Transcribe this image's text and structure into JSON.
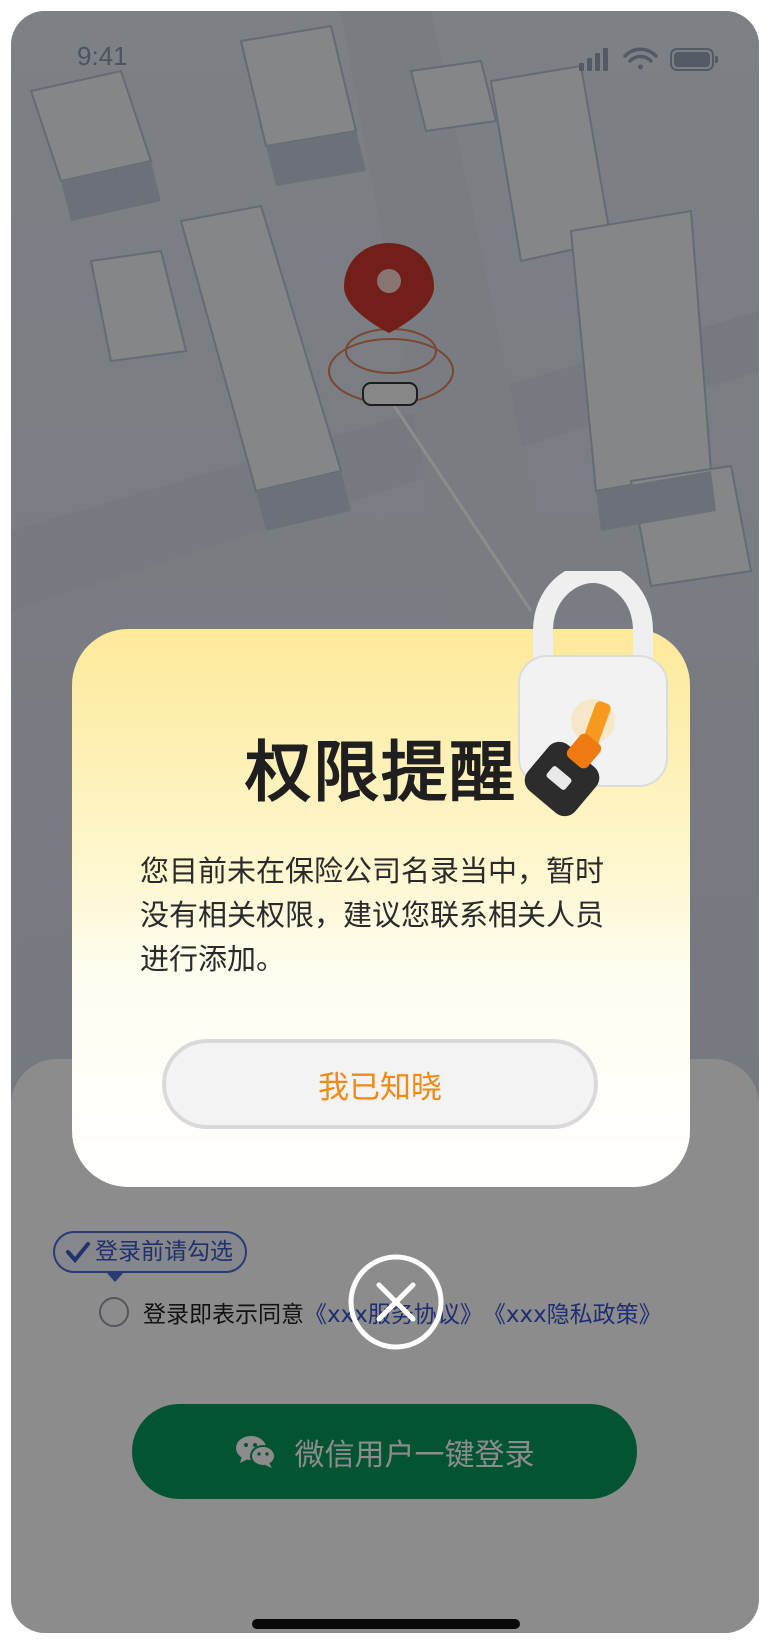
{
  "status_bar": {
    "time": "9:41"
  },
  "dialog": {
    "title": "权限提醒",
    "message": "您目前未在保险公司名录当中，暂时没有相关权限，建议您联系相关人员进行添加。",
    "confirm_label": "我已知晓"
  },
  "login_sheet": {
    "hint": "登录前请勾选",
    "agree_prefix": "登录即表示同意",
    "service_link": "《xxx服务协议》",
    "privacy_link": "《xxx隐私政策》",
    "wechat_button": "微信用户一键登录"
  },
  "colors": {
    "accent_orange": "#f08a12",
    "wechat_green": "#079a5c",
    "link_blue": "#3a55d0",
    "pin_red": "#d23a2e"
  },
  "icons": [
    "signal-icon",
    "wifi-icon",
    "battery-icon",
    "map-pin-icon",
    "lock-icon",
    "key-icon",
    "check-icon",
    "wechat-icon",
    "close-icon"
  ]
}
